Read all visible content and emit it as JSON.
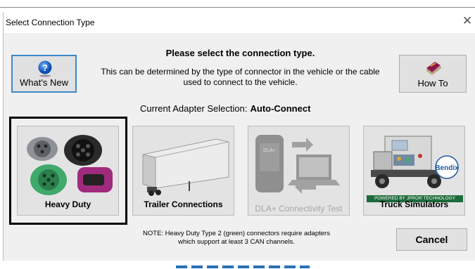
{
  "dialog": {
    "title": "Select Connection Type",
    "close_glyph": "✕",
    "heading": "Please select the connection type.",
    "description": "This can be determined by the type of connector in the vehicle or the cable used to connect to the vehicle.",
    "adapter_label": "Current Adapter Selection:",
    "adapter_value": "Auto-Connect",
    "note": "NOTE:  Heavy Duty Type 2 (green) connectors require adapters which support at least 3 CAN channels.",
    "cancel_label": "Cancel"
  },
  "side_buttons": {
    "whats_new": {
      "label": "What's New",
      "icon": "question-help-icon"
    },
    "how_to": {
      "label": "How To",
      "icon": "book-icon"
    }
  },
  "tiles": [
    {
      "label": "Heavy Duty",
      "icon": "connector-cables-image",
      "selected": true,
      "enabled": true
    },
    {
      "label": "Trailer Connections",
      "icon": "trailer-image",
      "selected": false,
      "enabled": true
    },
    {
      "label": "DLA+ Connectivity Test",
      "icon": "dla-adapter-laptop-image",
      "selected": false,
      "enabled": false
    },
    {
      "label": "Truck Simulators",
      "icon": "truck-simulator-image",
      "selected": false,
      "enabled": true,
      "banner": "POWERED BY JPRO® TECHNOLOGY",
      "badge": "Bendix"
    }
  ],
  "colors": {
    "selection_border": "#000000",
    "focus_border": "#3c87c9",
    "dialog_bg": "#f0f0f0"
  }
}
